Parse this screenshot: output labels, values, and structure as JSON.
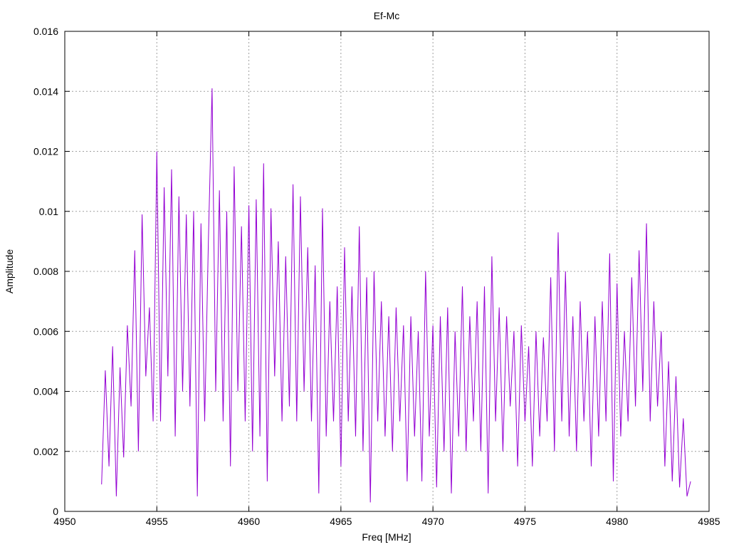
{
  "chart_data": {
    "type": "line",
    "title": "Ef-Mc",
    "xlabel": "Freq [MHz]",
    "ylabel": "Amplitude",
    "xlim": [
      4950,
      4985
    ],
    "ylim": [
      0,
      0.016
    ],
    "xticks": [
      "4950",
      "4955",
      "4960",
      "4965",
      "4970",
      "4975",
      "4980",
      "4985"
    ],
    "yticks": [
      "0",
      "0.002",
      "0.004",
      "0.006",
      "0.008",
      "0.01",
      "0.012",
      "0.014",
      "0.016"
    ],
    "grid": true,
    "series": [
      {
        "name": "Ef-Mc",
        "color": "#9400d3",
        "x_start": 4952,
        "x_step": 0.2,
        "values": [
          0.0009,
          0.0047,
          0.0015,
          0.0055,
          0.0005,
          0.0048,
          0.0018,
          0.0062,
          0.0035,
          0.0087,
          0.002,
          0.0099,
          0.0045,
          0.0068,
          0.003,
          0.012,
          0.003,
          0.0108,
          0.0045,
          0.0114,
          0.0025,
          0.0105,
          0.004,
          0.0099,
          0.0035,
          0.01,
          0.0005,
          0.0096,
          0.003,
          0.009,
          0.0141,
          0.004,
          0.0107,
          0.003,
          0.01,
          0.0015,
          0.0115,
          0.004,
          0.0095,
          0.003,
          0.0102,
          0.002,
          0.0104,
          0.0025,
          0.0116,
          0.001,
          0.0101,
          0.0045,
          0.009,
          0.003,
          0.0085,
          0.0035,
          0.0109,
          0.003,
          0.0105,
          0.004,
          0.0088,
          0.003,
          0.0082,
          0.0006,
          0.0101,
          0.0025,
          0.007,
          0.003,
          0.0075,
          0.0015,
          0.0088,
          0.003,
          0.0075,
          0.0025,
          0.0095,
          0.002,
          0.0078,
          0.0003,
          0.008,
          0.003,
          0.007,
          0.0025,
          0.0065,
          0.002,
          0.0068,
          0.003,
          0.0062,
          0.001,
          0.0065,
          0.0025,
          0.006,
          0.001,
          0.008,
          0.0025,
          0.0062,
          0.0008,
          0.0065,
          0.002,
          0.0068,
          0.0006,
          0.006,
          0.0025,
          0.0075,
          0.002,
          0.0065,
          0.003,
          0.007,
          0.002,
          0.0075,
          0.0006,
          0.0085,
          0.003,
          0.0068,
          0.002,
          0.0065,
          0.0035,
          0.006,
          0.0015,
          0.0062,
          0.003,
          0.0055,
          0.0015,
          0.006,
          0.0025,
          0.0058,
          0.003,
          0.0078,
          0.002,
          0.0093,
          0.003,
          0.008,
          0.0025,
          0.0065,
          0.002,
          0.007,
          0.003,
          0.006,
          0.0015,
          0.0065,
          0.0025,
          0.007,
          0.003,
          0.0086,
          0.001,
          0.0076,
          0.0025,
          0.006,
          0.003,
          0.0078,
          0.0035,
          0.0087,
          0.004,
          0.0096,
          0.003,
          0.007,
          0.0035,
          0.006,
          0.0015,
          0.005,
          0.001,
          0.0045,
          0.0008,
          0.0031,
          0.0005,
          0.001
        ]
      }
    ]
  }
}
